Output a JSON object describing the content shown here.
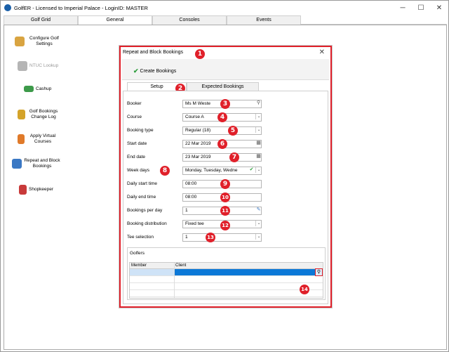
{
  "window": {
    "title": "GolfER - Licensed to Imperial Palace - LoginID: MASTER",
    "controls": {
      "minimize": "─",
      "maximize": "☐",
      "close": "✕"
    }
  },
  "main_tabs": [
    {
      "label": "Golf Grid"
    },
    {
      "label": "General"
    },
    {
      "label": "Consoles"
    },
    {
      "label": "Events"
    }
  ],
  "sidebar": {
    "items": [
      {
        "label": "Configure Golf Settings",
        "icon": "golf-settings-icon",
        "color": "#d9a441"
      },
      {
        "label": "NTUC Lookup",
        "icon": "ntuc-lookup-icon",
        "color": "#9a9a9a"
      },
      {
        "label": "Cashup",
        "icon": "cash-icon",
        "color": "#3d9a4a"
      },
      {
        "label": "Golf Bookings Change Log",
        "icon": "change-log-icon",
        "color": "#d4a32a"
      },
      {
        "label": "Apply Virtual Courses",
        "icon": "virtual-course-icon",
        "color": "#e07a2a"
      },
      {
        "label": "Repeat and Block Bookings",
        "icon": "repeat-bookings-icon",
        "color": "#3a78c4"
      },
      {
        "label": "Shopkeeper",
        "icon": "shopkeeper-icon",
        "color": "#c83a3a"
      }
    ]
  },
  "dialog": {
    "title": "Repeat and Block Bookings",
    "close": "✕",
    "create_label": "Create Bookings",
    "tabs": [
      {
        "label": "Setup"
      },
      {
        "label": "Expected Bookings"
      }
    ],
    "fields": {
      "booker": {
        "label": "Booker",
        "value": "Ms M Weste"
      },
      "course": {
        "label": "Course",
        "value": "Course A"
      },
      "booking_type": {
        "label": "Booking type",
        "value": "Regular (18)"
      },
      "start_date": {
        "label": "Start date",
        "value": "22 Mar 2019"
      },
      "end_date": {
        "label": "End date",
        "value": "23 Mar 2019"
      },
      "week_days": {
        "label": "Week days",
        "value": "Monday, Tuesday, Wedne"
      },
      "daily_start": {
        "label": "Daily start time",
        "value": "08:00"
      },
      "daily_end": {
        "label": "Daily end time",
        "value": "08:00"
      },
      "bookings_per_day": {
        "label": "Bookings per day",
        "value": "1"
      },
      "distribution": {
        "label": "Booking distribution",
        "value": "Fixed tee"
      },
      "tee_selection": {
        "label": "Tee selection",
        "value": "1"
      }
    },
    "golfers": {
      "title": "Golfers",
      "columns": [
        "Member",
        "Client"
      ]
    },
    "badges": [
      "1",
      "2",
      "3",
      "4",
      "5",
      "6",
      "7",
      "8",
      "9",
      "10",
      "11",
      "12",
      "13",
      "14"
    ],
    "accent_color": "#e0202a",
    "selection_color": "#0b78d7"
  }
}
